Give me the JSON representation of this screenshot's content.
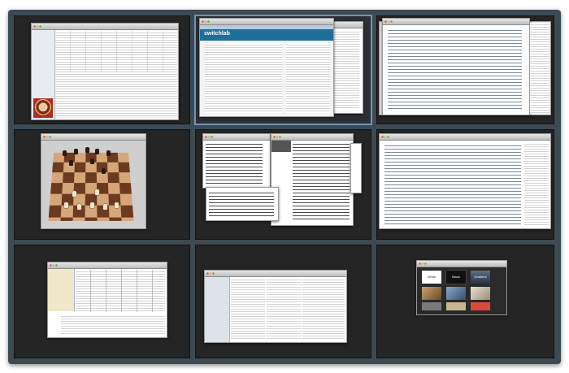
{
  "spaces_overview": {
    "active_space": 2,
    "spaces": [
      {
        "id": 1,
        "window": "Mail viewer"
      },
      {
        "id": 2,
        "window": "Browser"
      },
      {
        "id": 3,
        "window": "Document"
      },
      {
        "id": 4,
        "window": "Chess"
      },
      {
        "id": 5,
        "window": "Terminal windows"
      },
      {
        "id": 6,
        "window": "Code editor"
      },
      {
        "id": 7,
        "window": "Spreadsheet"
      },
      {
        "id": 8,
        "window": "Finder"
      },
      {
        "id": 9,
        "window": "Keynote theme chooser"
      }
    ]
  },
  "browser": {
    "logo_text": "switchlab"
  },
  "keynote": {
    "themes": [
      {
        "name": "White",
        "bg": "#ffffff",
        "fg": "#333333"
      },
      {
        "name": "Black",
        "bg": "#111111",
        "fg": "#ffffff"
      },
      {
        "name": "Gradient",
        "bg": "#3a4c63",
        "fg": "#ffffff"
      }
    ]
  },
  "colors": {
    "desktop_frame": "#3e4a52",
    "space_bg": "#252525",
    "active_highlight": "#6f95b8"
  }
}
